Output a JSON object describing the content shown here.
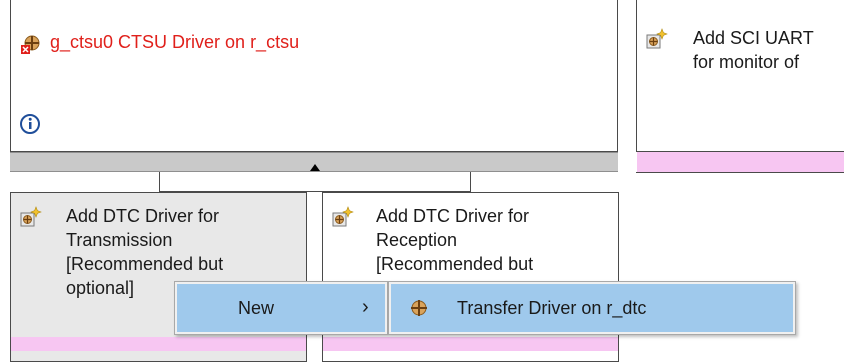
{
  "top_left_box": {
    "title": "g_ctsu0 CTSU Driver on r_ctsu",
    "title_color": "#e0201b",
    "icon": "module-error-icon",
    "info_icon": "info-icon",
    "collapse_icon": "collapse-up-icon"
  },
  "top_right_box": {
    "line1": "Add SCI UART",
    "line2": "for monitor of",
    "icon": "add-module-icon"
  },
  "bottom_left_box": {
    "lines": [
      "Add DTC Driver for",
      "Transmission",
      "[Recommended but",
      "optional]"
    ],
    "icon": "add-module-icon"
  },
  "bottom_middle_box": {
    "lines": [
      "Add DTC Driver for",
      "Reception",
      "[Recommended but"
    ],
    "icon": "add-module-icon"
  },
  "context_menu": {
    "new_label": "New",
    "arrow": "›",
    "submenu_item_label": "Transfer Driver on r_dtc",
    "submenu_item_icon": "module-icon"
  },
  "colors": {
    "pink": "#f7c6f2",
    "highlight": "#9fc9ec",
    "gray_bar": "#c9c9c9",
    "error_red": "#e0201b"
  }
}
